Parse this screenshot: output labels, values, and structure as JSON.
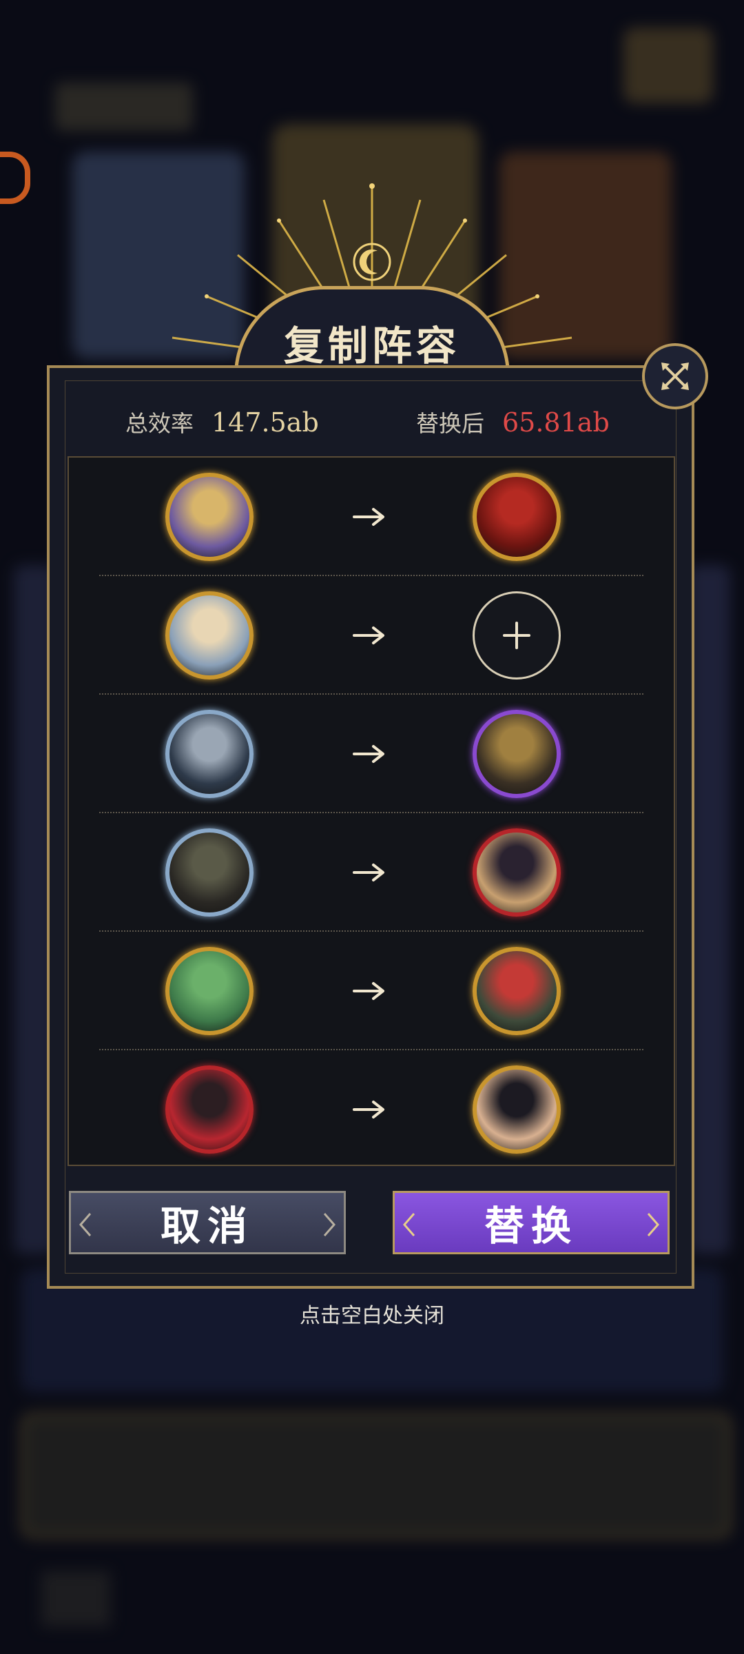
{
  "dialog": {
    "title": "复制阵容",
    "stats": {
      "total_label": "总效率",
      "total_value": "147.5ab",
      "after_label": "替换后",
      "after_value": "65.81ab"
    },
    "rows": [
      {
        "from": {
          "name": "gold-armored-lavender-hair-hero",
          "ring": "#c9962e"
        },
        "to": {
          "name": "dark-hair-jeweled-hero",
          "ring": "#c9962e"
        }
      },
      {
        "from": {
          "name": "red-lion-hero",
          "ring": "#c9962e"
        },
        "to": {
          "empty": true
        }
      },
      {
        "from": {
          "name": "blonde-curly-hair-hero",
          "ring": "#8aa9c9"
        },
        "to": {
          "name": "green-hair-glasses-hero",
          "ring": "#8a4ad0"
        }
      },
      {
        "from": {
          "name": "silver-hair-masked-hero",
          "ring": "#8aa9c9"
        },
        "to": {
          "name": "twin-dragon-riders-hero",
          "ring": "#b7252a"
        }
      },
      {
        "from": {
          "name": "golden-helmet-warrior-hero",
          "ring": "#c9962e"
        },
        "to": {
          "name": "dark-red-mecha-hero",
          "ring": "#c9962e"
        }
      },
      {
        "from": {
          "name": "bronze-beast-hero",
          "ring": "#b7252a"
        },
        "to": {
          "name": "black-hair-flower-hero",
          "ring": "#c9962e"
        }
      }
    ],
    "buttons": {
      "cancel": "取消",
      "replace": "替换"
    },
    "hint": "点击空白处关闭"
  },
  "colors": {
    "accent_gold": "#c9a45a",
    "value_red": "#e04a48",
    "button_purple": "#7a48d4"
  },
  "icons": [
    "close-icon",
    "arrow-right-icon",
    "plus-icon",
    "moon-icon"
  ]
}
